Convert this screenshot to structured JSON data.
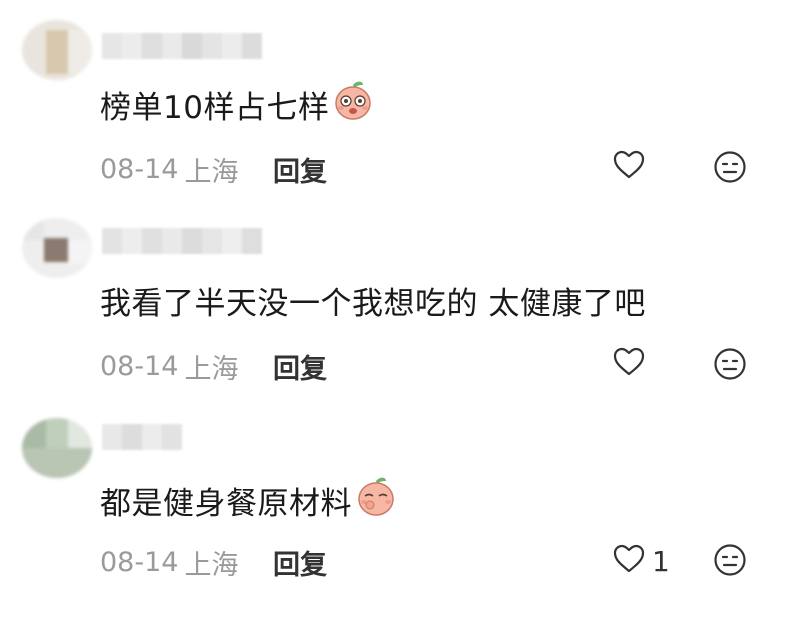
{
  "comments": [
    {
      "text": "榜单10样占七样",
      "has_emoji": true,
      "date": "08-14",
      "location": "上海",
      "reply_label": "回复",
      "like_count": "",
      "like_icon": "heart-outline-icon",
      "dislike_icon": "meh-face-icon"
    },
    {
      "text": "我看了半天没一个我想吃的 太健康了吧",
      "has_emoji": false,
      "date": "08-14",
      "location": "上海",
      "reply_label": "回复",
      "like_count": "",
      "like_icon": "heart-outline-icon",
      "dislike_icon": "meh-face-icon"
    },
    {
      "text": "都是健身餐原材料",
      "has_emoji": true,
      "date": "08-14",
      "location": "上海",
      "reply_label": "回复",
      "like_count": "1",
      "like_icon": "heart-outline-icon",
      "dislike_icon": "meh-face-icon"
    }
  ],
  "colors": {
    "text": "#1a1a1a",
    "meta": "#9a9a9a",
    "reply": "#333333",
    "emoji_peach": "#f6b8a4"
  }
}
